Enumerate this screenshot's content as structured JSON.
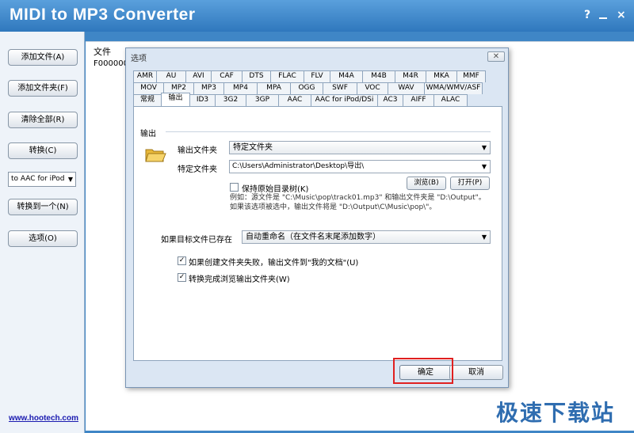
{
  "app": {
    "title": "MIDI to MP3 Converter",
    "help": "?",
    "close": "×"
  },
  "sidebar": {
    "add_files": "添加文件(A)",
    "add_folder": "添加文件夹(F)",
    "clear_all": "清除全部(R)",
    "convert": "转换(C)",
    "format_select": "to AAC for iPod",
    "convert_to_one": "转换到一个(N)",
    "options": "选项(O)",
    "website": "www.hootech.com"
  },
  "filelist": {
    "header": "文件",
    "row1": "F000000"
  },
  "watermark": "极速下载站",
  "dialog": {
    "title": "选项",
    "close": "✕",
    "tabs_row1": [
      "AMR",
      "AU",
      "AVI",
      "CAF",
      "DTS",
      "FLAC",
      "FLV",
      "M4A",
      "M4B",
      "M4R",
      "MKA",
      "MMF"
    ],
    "tabs_row2": [
      "MOV",
      "MP2",
      "MP3",
      "MP4",
      "MPA",
      "OGG",
      "SWF",
      "VOC",
      "WAV",
      "WMA/WMV/ASF"
    ],
    "tabs_row3": [
      "常规",
      "输出",
      "ID3",
      "3G2",
      "3GP",
      "AAC",
      "AAC for iPod/DSi",
      "AC3",
      "AIFF",
      "ALAC"
    ],
    "active_tab": "输出",
    "section_output": "输出",
    "output_folder_label": "输出文件夹",
    "output_folder_value": "特定文件夹",
    "specific_folder_label": "特定文件夹",
    "specific_folder_value": "C:\\Users\\Administrator\\Desktop\\导出\\",
    "browse": "浏览(B)",
    "open": "打开(P)",
    "keep_tree": "保持原始目录树(K)",
    "note_line1": "例如：源文件是 \"C:\\Music\\pop\\track01.mp3\" 和输出文件夹是 \"D:\\Output\"。",
    "note_line2": "如果该选项被选中，输出文件将是 \"D:\\Output\\C\\Music\\pop\\\"。",
    "exists_label": "如果目标文件已存在",
    "exists_value": "自动重命名（在文件名末尾添加数字）",
    "fail_option": "如果创建文件夹失败，输出文件到\"我的文档\"(U)",
    "browse_option": "转换完成浏览输出文件夹(W)",
    "ok": "确定",
    "cancel": "取消"
  },
  "colors": {
    "titlebar": "#2f78bd",
    "highlight": "#e02020",
    "link": "#1a1ab0"
  }
}
